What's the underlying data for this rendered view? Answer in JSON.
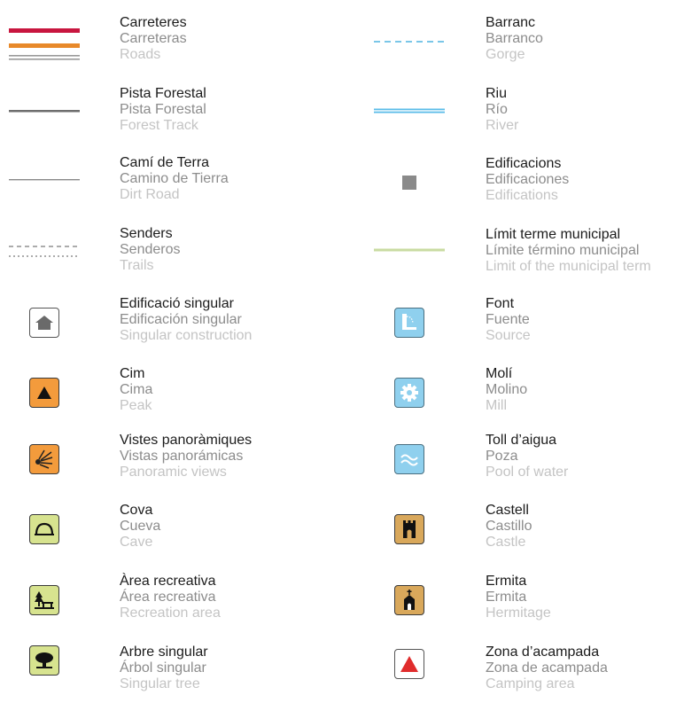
{
  "legend": {
    "left": [
      {
        "ca": "Carreteres",
        "es": "Carreteras",
        "en": "Roads",
        "symbol": "roads-lines-icon"
      },
      {
        "ca": "Pista Forestal",
        "es": "Pista Forestal",
        "en": "Forest Track",
        "symbol": "forest-track-line-icon"
      },
      {
        "ca": "Camí de Terra",
        "es": "Camino de Tierra",
        "en": "Dirt Road",
        "symbol": "dirt-road-line-icon"
      },
      {
        "ca": "Senders",
        "es": "Senderos",
        "en": "Trails",
        "symbol": "trails-dashed-line-icon"
      },
      {
        "ca": "Edificació singular",
        "es": "Edificación singular",
        "en": "Singular construction",
        "symbol": "house-icon"
      },
      {
        "ca": "Cim",
        "es": "Cima",
        "en": "Peak",
        "symbol": "peak-triangle-icon"
      },
      {
        "ca": "Vistes panoràmiques",
        "es": "Vistas panorámicas",
        "en": "Panoramic views",
        "symbol": "panoramic-view-icon"
      },
      {
        "ca": "Cova",
        "es": "Cueva",
        "en": "Cave",
        "symbol": "cave-arch-icon"
      },
      {
        "ca": "Àrea recreativa",
        "es": "Área recreativa",
        "en": "Recreation area",
        "symbol": "picnic-table-icon"
      },
      {
        "ca": "Arbre singular",
        "es": "Árbol singular",
        "en": "Singular tree",
        "symbol": "tree-icon"
      }
    ],
    "right": [
      {
        "ca": "Barranc",
        "es": "Barranco",
        "en": "Gorge",
        "symbol": "gorge-dashed-line-icon"
      },
      {
        "ca": "Riu",
        "es": "Río",
        "en": "River",
        "symbol": "river-line-icon"
      },
      {
        "ca": "Edificacions",
        "es": "Edificaciones",
        "en": "Edifications",
        "symbol": "building-square-icon"
      },
      {
        "ca": "Límit terme municipal",
        "es": "Límite término municipal",
        "en": "Limit of the municipal term",
        "symbol": "municipal-limit-line-icon"
      },
      {
        "ca": "Font",
        "es": "Fuente",
        "en": "Source",
        "symbol": "fountain-icon"
      },
      {
        "ca": "Molí",
        "es": "Molino",
        "en": "Mill",
        "symbol": "mill-gear-icon"
      },
      {
        "ca": "Toll d’aigua",
        "es": "Poza",
        "en": "Pool of water",
        "symbol": "water-waves-icon"
      },
      {
        "ca": "Castell",
        "es": "Castillo",
        "en": "Castle",
        "symbol": "castle-tower-icon"
      },
      {
        "ca": "Ermita",
        "es": "Ermita",
        "en": "Hermitage",
        "symbol": "hermitage-chapel-icon"
      },
      {
        "ca": "Zona d’acampada",
        "es": "Zona de acampada",
        "en": "Camping area",
        "symbol": "camping-tent-icon"
      }
    ]
  },
  "colors": {
    "road_red": "#c8163f",
    "road_orange": "#e8892a",
    "road_grey": "#9a9a9a",
    "track_grey": "#6e6e6e",
    "gorge_blue": "#4fb3e0",
    "river_blue": "#5bbce8",
    "building_grey": "#8a8a8a",
    "limit_green": "#c9dba2",
    "orange_box": "#f39b3c",
    "green_box": "#d7e38f",
    "blue_box": "#8fd0ee",
    "tan_box": "#d9a85b",
    "camping_red": "#e02c2c"
  }
}
